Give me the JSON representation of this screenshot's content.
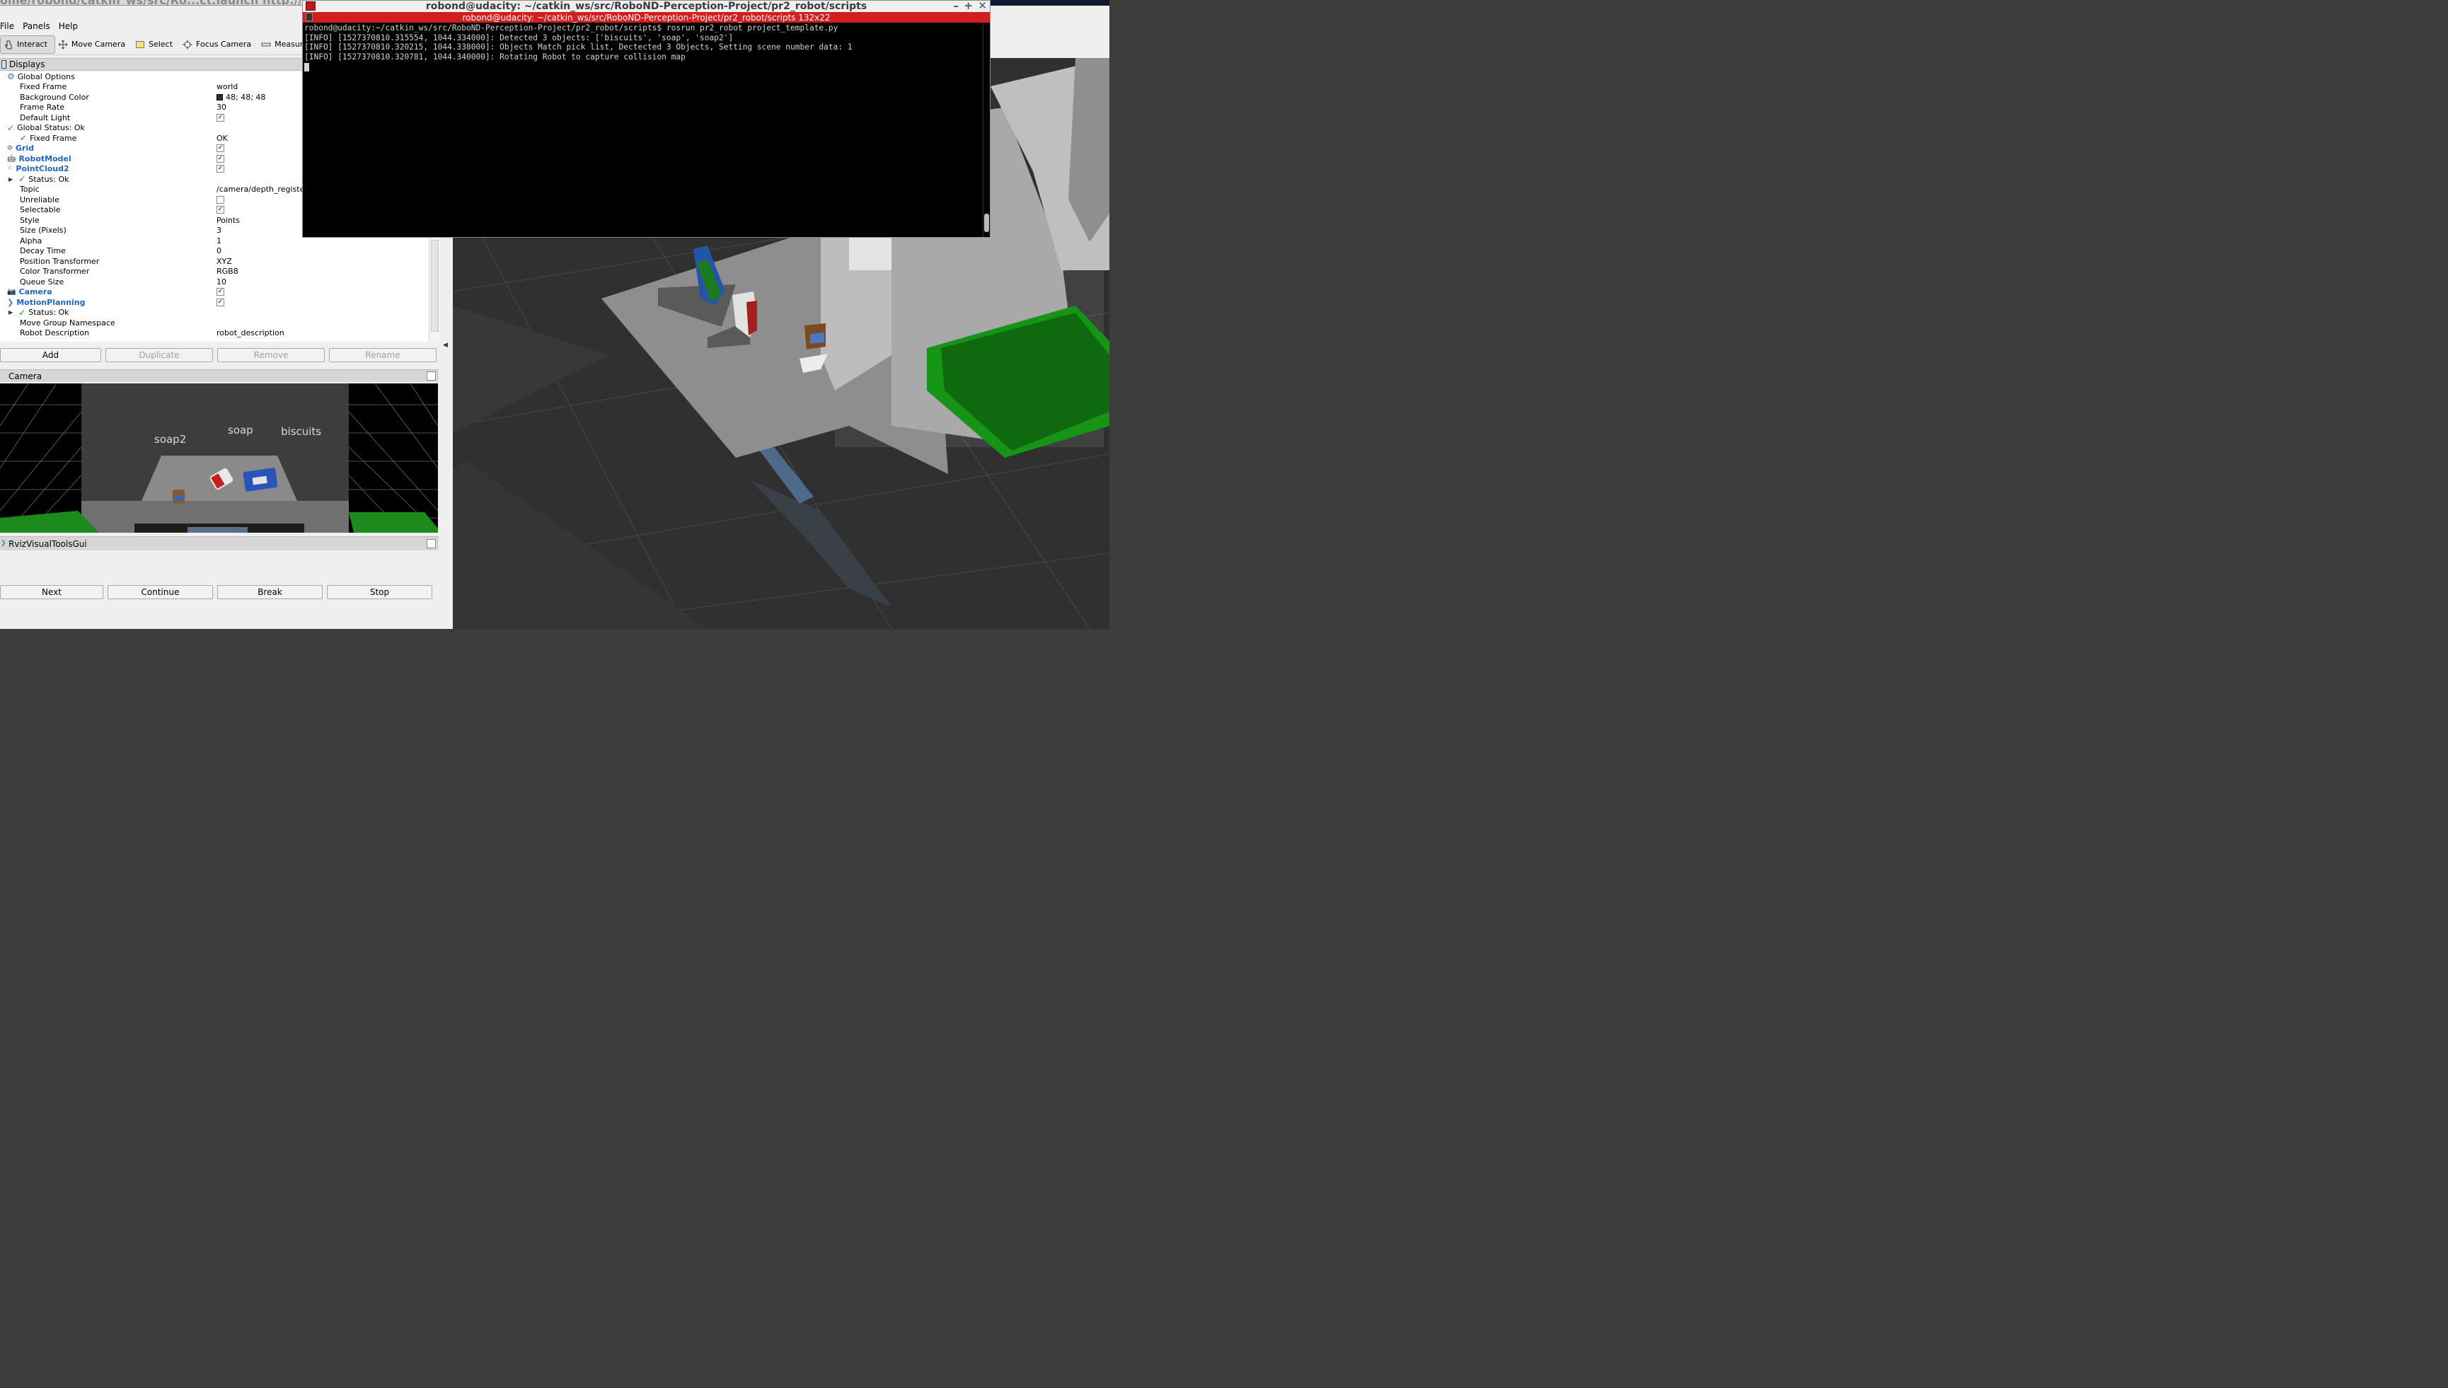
{
  "rviz": {
    "title": "ome/robond/catkin_ws/src/Ro...ct.launch http://localhos",
    "menu": [
      "File",
      "Panels",
      "Help"
    ],
    "tools": [
      {
        "label": "Interact",
        "icon": "interact-icon"
      },
      {
        "label": "Move Camera",
        "icon": "move-camera-icon"
      },
      {
        "label": "Select",
        "icon": "select-icon"
      },
      {
        "label": "Focus Camera",
        "icon": "focus-camera-icon"
      },
      {
        "label": "Measure",
        "icon": "measure-icon"
      }
    ]
  },
  "displays": {
    "title": "Displays",
    "rows": [
      {
        "key": "Global Options",
        "value": ""
      },
      {
        "key": "Fixed Frame",
        "value": "world"
      },
      {
        "key": "Background Color",
        "value": "48; 48; 48"
      },
      {
        "key": "Frame Rate",
        "value": "30"
      },
      {
        "key": "Default Light",
        "value": ""
      },
      {
        "key": "Global Status: Ok",
        "value": ""
      },
      {
        "key": "Fixed Frame",
        "value": "OK"
      },
      {
        "key": "Grid",
        "value": ""
      },
      {
        "key": "RobotModel",
        "value": ""
      },
      {
        "key": "PointCloud2",
        "value": ""
      },
      {
        "key": "Status: Ok",
        "value": ""
      },
      {
        "key": "Topic",
        "value": "/camera/depth_registe"
      },
      {
        "key": "Unreliable",
        "value": ""
      },
      {
        "key": "Selectable",
        "value": ""
      },
      {
        "key": "Style",
        "value": "Points"
      },
      {
        "key": "Size (Pixels)",
        "value": "3"
      },
      {
        "key": "Alpha",
        "value": "1"
      },
      {
        "key": "Decay Time",
        "value": "0"
      },
      {
        "key": "Position Transformer",
        "value": "XYZ"
      },
      {
        "key": "Color Transformer",
        "value": "RGB8"
      },
      {
        "key": "Queue Size",
        "value": "10"
      },
      {
        "key": "Camera",
        "value": ""
      },
      {
        "key": "MotionPlanning",
        "value": ""
      },
      {
        "key": "Status: Ok",
        "value": ""
      },
      {
        "key": "Move Group Namespace",
        "value": ""
      },
      {
        "key": "Robot Description",
        "value": "robot_description"
      }
    ],
    "buttons": [
      "Add",
      "Duplicate",
      "Remove",
      "Rename"
    ]
  },
  "camera": {
    "title": "Camera",
    "labels": [
      "soap2",
      "soap",
      "biscuits"
    ]
  },
  "rviz_visual_tools": {
    "title": "RvizVisualToolsGui",
    "buttons": [
      "Next",
      "Continue",
      "Break",
      "Stop"
    ]
  },
  "terminal": {
    "title": "robond@udacity: ~/catkin_ws/src/RoboND-Perception-Project/pr2_robot/scripts",
    "tab_title": "robond@udacity: ~/catkin_ws/src/RoboND-Perception-Project/pr2_robot/scripts 132x22",
    "lines": [
      "robond@udacity:~/catkin_ws/src/RoboND-Perception-Project/pr2_robot/scripts$ rosrun pr2_robot project_template.py",
      "[INFO] [1527370810.315554, 1044.334000]: Detected 3 objects: ['biscuits', 'soap', 'soap2']",
      "[INFO] [1527370810.320215, 1044.338000]: Objects Match pick list, Dectected 3 Objects, Setting scene number data: 1",
      "[INFO] [1527370810.320781, 1044.340000]: Rotating Robot to capture collision map"
    ]
  },
  "colors": {
    "terminal_tab": "#d21e1e",
    "display_name": "#1f67c3",
    "status_check": "#1e9a1e",
    "viewport_background": "#303030"
  }
}
